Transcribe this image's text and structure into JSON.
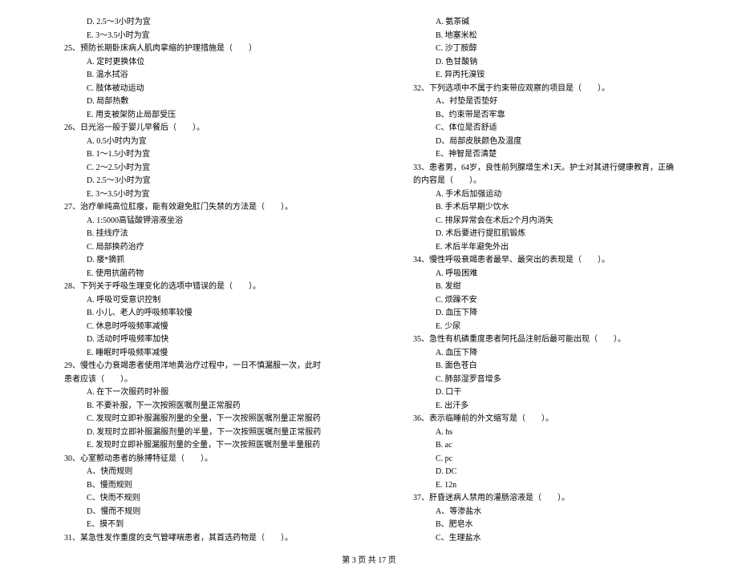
{
  "left": {
    "pre_options": [
      "D. 2.5～3小时为宜",
      "E. 3～3.5小时为宜"
    ],
    "q25": {
      "text": "25、预防长期卧床病人肌肉挛缩的护理措施是（　　）",
      "options": [
        "A. 定时更换体位",
        "B. 温水拭浴",
        "C. 肢体被动运动",
        "D. 局部热敷",
        "E. 用支被架防止局部受压"
      ]
    },
    "q26": {
      "text": "26、日光浴一般于婴儿早餐后（　　）。",
      "options": [
        "A. 0.5小时内为宜",
        "B. 1～1.5小时为宜",
        "C. 2～2.5小时为宜",
        "D. 2.5～3小时为宜",
        "E. 3～3.5小时为宜"
      ]
    },
    "q27": {
      "text": "27、治疗单纯高位肛瘘，能有效避免肛门失禁的方法是（　　）。",
      "options": [
        "A. 1:5000高锰酸钾溶液坐浴",
        "B. 挂线疗法",
        "C. 局部换药治疗",
        "D. 瘘*摘抓",
        "E. 使用抗菌药物"
      ]
    },
    "q28": {
      "text": "28、下列关于呼吸生理变化的选项中错误的是（　　）。",
      "options": [
        "A. 呼吸可受意识控制",
        "B. 小儿、老人的呼吸频率较慢",
        "C. 休息时呼吸频率减慢",
        "D. 活动时呼吸频率加快",
        "E. 睡眠时呼吸频率减慢"
      ]
    },
    "q29": {
      "text": "29、慢性心力衰竭患者使用洋地黄治疗过程中，一日不慎漏服一次，此时患者应该（　　）。",
      "options": [
        "A. 在下一次服药时补服",
        "B. 不要补服，下一次按照医嘱剂量正常服药",
        "C. 发现时立即补服漏服剂量的全量，下一次按照医嘱剂量正常服药",
        "D. 发现时立即补服漏服剂量的半量，下一次按照医嘱剂量正常服药",
        "E. 发现时立即补服漏服剂量的全量，下一次按照医嘱剂量半量服药"
      ]
    },
    "q30": {
      "text": "30、心室颤动患者的脉搏特征是（　　）。",
      "options": [
        "A、快而规则",
        "B、慢而规则",
        "C、快而不规则",
        "D、慢而不规则",
        "E、摸不到"
      ]
    },
    "q31": {
      "text": "31、某急性发作重度的支气管哮喘患者，其首选药物是（　　）。"
    }
  },
  "right": {
    "pre_options": [
      "A. 氨茶碱",
      "B. 地塞米松",
      "C. 沙丁胺醇",
      "D. 色甘酸钠",
      "E. 异丙托溴铵"
    ],
    "q32": {
      "text": "32、下列选项中不属于约束带应观察的项目是（　　）。",
      "options": [
        "A、衬垫是否垫好",
        "B、约束带是否牢靠",
        "C、体位是否舒适",
        "D、局部皮肤颜色及温度",
        "E、神智是否清楚"
      ]
    },
    "q33": {
      "text": "33、患者男，64岁，良性前列腺增生术1天。护士对其进行健康教育，正确的内容是（　　）。",
      "options": [
        "A. 手术后加强运动",
        "B. 手术后早期少饮水",
        "C. 排尿异常会在术后2个月内消失",
        "D. 术后要进行提肛肌锻炼",
        "E. 术后半年避免外出"
      ]
    },
    "q34": {
      "text": "34、慢性呼吸衰竭患者最早、最突出的表现是（　　）。",
      "options": [
        "A. 呼吸困难",
        "B. 发绀",
        "C. 烦躁不安",
        "D. 血压下降",
        "E. 少尿"
      ]
    },
    "q35": {
      "text": "35、急性有机磷重度患者阿托品注射后最可能出现（　　）。",
      "options": [
        "A. 血压下降",
        "B. 面色苍白",
        "C. 肺部湿罗音增多",
        "D. 口干",
        "E. 出汗多"
      ]
    },
    "q36": {
      "text": "36、表示临睡前的外文缩写是（　　）。",
      "options": [
        "A. hs",
        "B. ac",
        "C. pc",
        "D. DC",
        "E. 12n"
      ]
    },
    "q37": {
      "text": "37、肝昏迷病人禁用的灌肠溶液是（　　）。",
      "options": [
        "A、等渗盐水",
        "B、肥皂水",
        "C、生理盐水"
      ]
    }
  },
  "footer": "第 3 页 共 17 页"
}
